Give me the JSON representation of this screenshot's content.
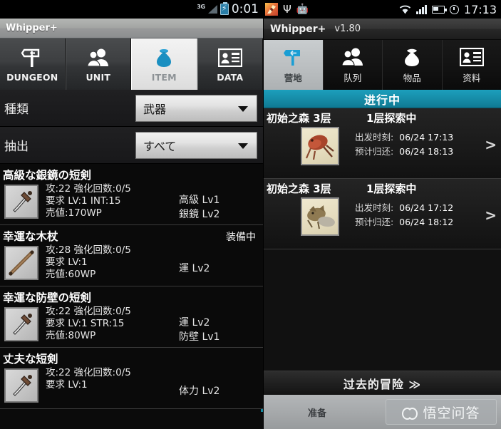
{
  "left": {
    "statusbar": {
      "network": "3G",
      "signal_icon": "signal-bars-icon",
      "battery_icon": "battery-charging-icon",
      "clock": "0:01"
    },
    "titlebar": {
      "app_title": "Whipper+"
    },
    "tabs": [
      {
        "label": "DUNGEON",
        "icon": "signpost-icon",
        "active": false
      },
      {
        "label": "UNIT",
        "icon": "people-icon",
        "active": false
      },
      {
        "label": "ITEM",
        "icon": "money-bag-icon",
        "active": true
      },
      {
        "label": "DATA",
        "icon": "id-card-icon",
        "active": false
      }
    ],
    "filters": [
      {
        "label": "種類",
        "value": "武器",
        "caret_icon": "chevron-down-icon"
      },
      {
        "label": "抽出",
        "value": "すべて",
        "caret_icon": "chevron-down-icon"
      }
    ],
    "items": [
      {
        "name": "高級な銀鏡の短剣",
        "equipped": "",
        "thumb_icon": "dagger-icon",
        "stat_attack": "攻:22 強化回数:0/5",
        "stat_require": "要求 LV:1 INT:15",
        "stat_price": "売値:170WP",
        "tags": [
          "高級 Lv1",
          "銀鏡 Lv2"
        ]
      },
      {
        "name": "幸運な木杖",
        "equipped": "装備中",
        "thumb_icon": "staff-icon",
        "stat_attack": "攻:28 強化回数:0/5",
        "stat_require": "要求 LV:1",
        "stat_price": "売値:60WP",
        "tags": [
          "運 Lv2"
        ]
      },
      {
        "name": "幸運な防壁の短剣",
        "equipped": "",
        "thumb_icon": "dagger-icon",
        "stat_attack": "攻:22 強化回数:0/5",
        "stat_require": "要求 LV:1 STR:15",
        "stat_price": "売値:80WP",
        "tags": [
          "運 Lv2",
          "防壁 Lv1"
        ]
      },
      {
        "name": "丈夫な短剣",
        "equipped": "",
        "thumb_icon": "dagger-icon",
        "stat_attack": "攻:22 強化回数:0/5",
        "stat_require": "要求 LV:1",
        "stat_price": "",
        "tags": [
          "体力 Lv2"
        ]
      }
    ]
  },
  "right": {
    "statusbar": {
      "app_icon": "app-launcher-icon",
      "usb_icon": "usb-debug-icon",
      "android_icon": "android-robot-icon",
      "wifi_icon": "wifi-icon",
      "signal_icon": "signal-bars-icon",
      "battery_icon": "battery-icon",
      "alarm_icon": "alarm-clock-icon",
      "clock": "17:13"
    },
    "titlebar": {
      "app_title": "Whipper+",
      "version": "v1.80"
    },
    "tabs": [
      {
        "label": "营地",
        "icon": "signpost-icon",
        "active": true
      },
      {
        "label": "队列",
        "icon": "people-icon",
        "active": false
      },
      {
        "label": "物品",
        "icon": "money-bag-icon",
        "active": false
      },
      {
        "label": "资料",
        "icon": "id-card-icon",
        "active": false
      }
    ],
    "banner": {
      "title": "进行中"
    },
    "missions": [
      {
        "location": "初始之森 3层",
        "status": "1层探索中",
        "thumb_icon": "monster-portrait-icon",
        "depart_label": "出发时刻:",
        "depart_value": "06/24 17:13",
        "return_label": "预计归还:",
        "return_value": "06/24 18:13",
        "arrow_icon": "chevron-right-icon"
      },
      {
        "location": "初始之森 3层",
        "status": "1层探索中",
        "thumb_icon": "monster-portrait-icon",
        "depart_label": "出发时刻:",
        "depart_value": "06/24 17:12",
        "return_label": "预计归还:",
        "return_value": "06/24 18:12",
        "arrow_icon": "chevron-right-icon"
      }
    ],
    "past_adventures": {
      "label": "过去的冒险 ≫"
    },
    "sysbar": {
      "prepare_label": "准备",
      "watermark_text": "悟空问答",
      "watermark_logo": "wukong-logo-icon"
    }
  },
  "colors": {
    "accent_teal": "#168ba6",
    "tab_active_blue": "#2aa8d4",
    "panel_dark": "#0b0b0b"
  }
}
